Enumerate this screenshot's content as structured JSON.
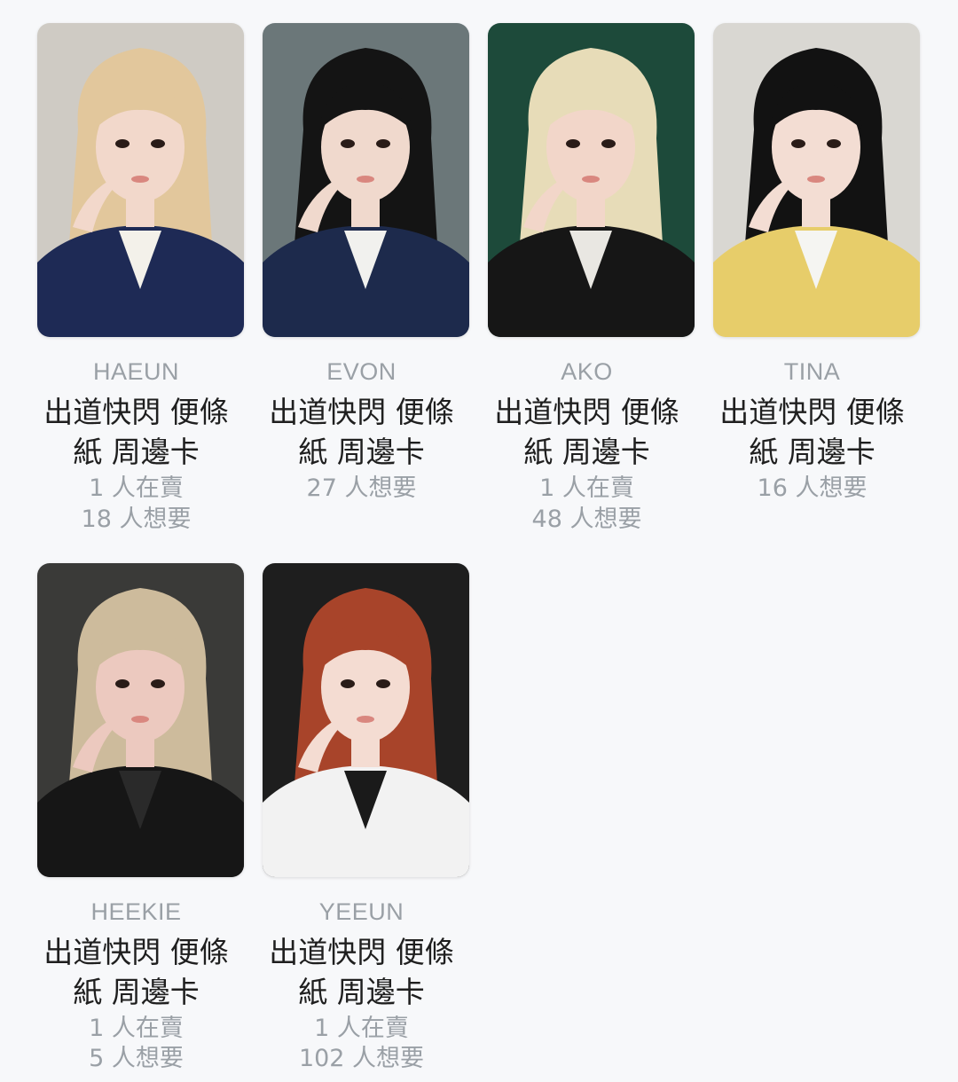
{
  "cards": [
    {
      "name": "HAEUN",
      "title_line1": "出道快閃 便條",
      "title_line2": "紙 周邊卡",
      "stat1": "1 人在賣",
      "stat2": "18 人想要",
      "photo": {
        "bg": "#cfcbc4",
        "hair": "#e2c79c",
        "skin": "#f2d8cb",
        "top": "#1e2a55",
        "accent": "#f3f1ea"
      }
    },
    {
      "name": "EVON",
      "title_line1": "出道快閃 便條",
      "title_line2": "紙 周邊卡",
      "stat1": "27 人想要",
      "stat2": "",
      "photo": {
        "bg": "#6b7779",
        "hair": "#141414",
        "skin": "#f0d9cd",
        "top": "#1d2a4c",
        "accent": "#f1f1ee"
      }
    },
    {
      "name": "AKO",
      "title_line1": "出道快閃 便條",
      "title_line2": "紙 周邊卡",
      "stat1": "1 人在賣",
      "stat2": "48 人想要",
      "photo": {
        "bg": "#1d4a3a",
        "hair": "#e7dcb8",
        "skin": "#f2d6c9",
        "top": "#161616",
        "accent": "#e9e7e2"
      }
    },
    {
      "name": "TINA",
      "title_line1": "出道快閃 便條",
      "title_line2": "紙 周邊卡",
      "stat1": "16 人想要",
      "stat2": "",
      "photo": {
        "bg": "#d9d7d2",
        "hair": "#121212",
        "skin": "#f3ddd3",
        "top": "#e7cd6a",
        "accent": "#f5f5f2"
      }
    },
    {
      "name": "HEEKIE",
      "title_line1": "出道快閃 便條",
      "title_line2": "紙 周邊卡",
      "stat1": "1 人在賣",
      "stat2": "5 人想要",
      "photo": {
        "bg": "#3a3a38",
        "hair": "#cdbb9c",
        "skin": "#ecc9bf",
        "top": "#161616",
        "accent": "#2a2a2a"
      }
    },
    {
      "name": "YEEUN",
      "title_line1": "出道快閃 便條",
      "title_line2": "紙 周邊卡",
      "stat1": "1 人在賣",
      "stat2": "102 人想要",
      "photo": {
        "bg": "#1e1e1e",
        "hair": "#a8442a",
        "skin": "#f4dcd2",
        "top": "#f2f2f2",
        "accent": "#1a1a1a"
      }
    }
  ]
}
